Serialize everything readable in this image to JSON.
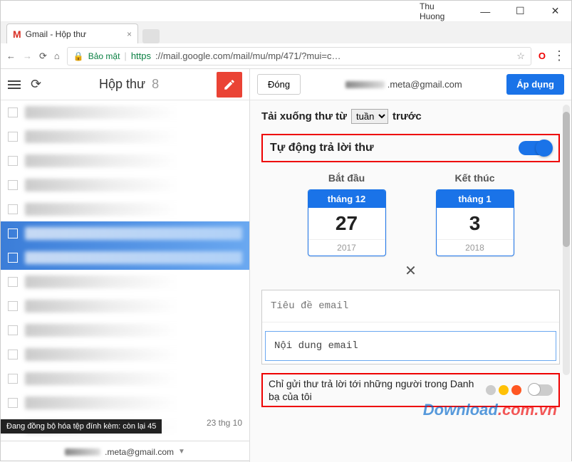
{
  "window": {
    "user": "Thu Huong"
  },
  "tab": {
    "title": "Gmail - Hộp thư"
  },
  "urlbar": {
    "secure_label": "Bảo mật",
    "url_https": "https",
    "url_rest": "://mail.google.com/mail/mu/mp/471/?mui=c…"
  },
  "left": {
    "title": "Hộp thư",
    "count": "8",
    "sync_msg": "Đang đồng bộ hóa tệp đính kèm: còn lại 45",
    "timestamp": "23 thg 10",
    "account_suffix": ".meta@gmail.com"
  },
  "right": {
    "close": "Đóng",
    "account_suffix": ".meta@gmail.com",
    "apply": "Áp dụng",
    "download_prefix": "Tải xuống thư từ",
    "download_period": "tuần",
    "download_suffix": "trước",
    "autoreply_label": "Tự động trả lời thư",
    "start_label": "Bắt đầu",
    "end_label": "Kết thúc",
    "start": {
      "month": "tháng 12",
      "day": "27",
      "year": "2017"
    },
    "end": {
      "month": "tháng 1",
      "day": "3",
      "year": "2018"
    },
    "subject_placeholder": "Tiêu đề email",
    "body_value": "Nội dung email",
    "contacts_only": "Chỉ gửi thư trả lời tới những người trong Danh bạ của tôi"
  },
  "watermark": {
    "a": "Download",
    "b": ".com.vn"
  }
}
